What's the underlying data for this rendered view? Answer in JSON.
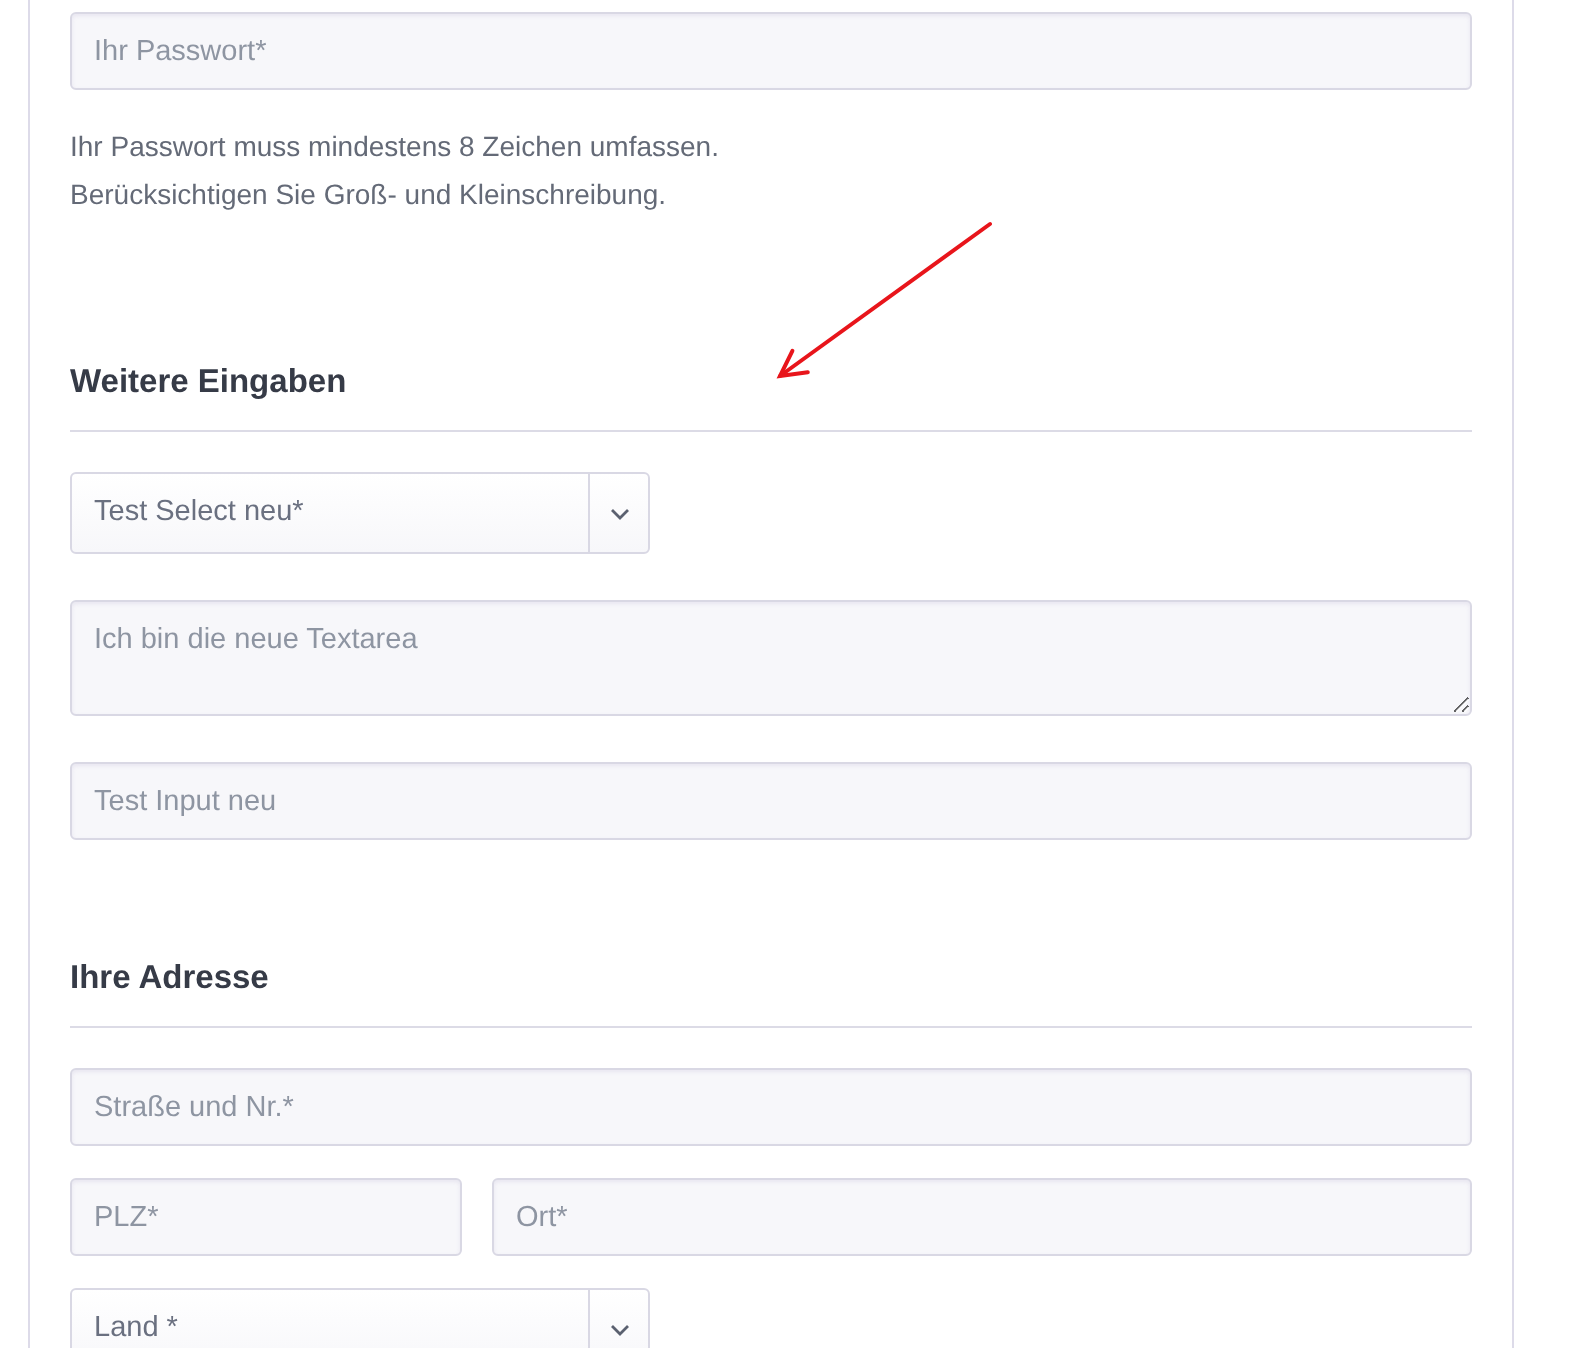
{
  "password": {
    "placeholder": "Ihr Passwort*"
  },
  "password_hint": [
    "Ihr Passwort muss mindestens 8 Zeichen umfassen.",
    "Berücksichtigen Sie Groß- und Kleinschreibung."
  ],
  "sections": [
    {
      "heading": "Weitere Eingaben",
      "rows": [
        [
          {
            "kind": "select",
            "value": "Test Select neu*"
          }
        ],
        [
          {
            "kind": "textarea",
            "placeholder": "Ich bin die neue Textarea"
          }
        ],
        [
          {
            "kind": "input",
            "placeholder": "Test Input neu"
          }
        ]
      ]
    },
    {
      "heading": "Ihre Adresse",
      "rows": [
        [
          {
            "kind": "input",
            "placeholder": "Straße und Nr.*"
          }
        ],
        [
          {
            "kind": "input",
            "placeholder": "PLZ*"
          },
          {
            "kind": "input",
            "placeholder": "Ort*"
          }
        ],
        [
          {
            "kind": "select",
            "value": "Land *"
          }
        ]
      ]
    }
  ]
}
